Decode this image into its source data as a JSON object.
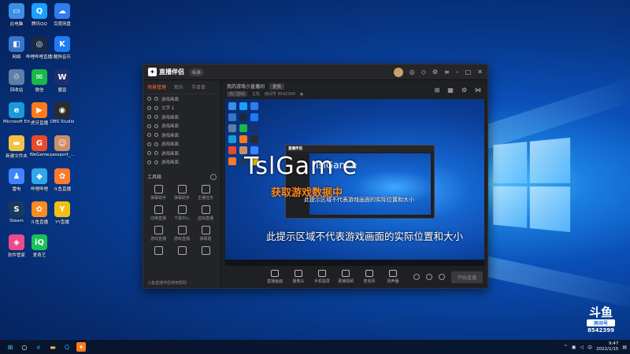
{
  "desktop": {
    "icons": [
      {
        "label": "此电脑",
        "color": "#3a8ee6",
        "glyph": "▭"
      },
      {
        "label": "腾讯QQ",
        "color": "#1aa0ff",
        "glyph": "Q"
      },
      {
        "label": "百度网盘",
        "color": "#2f7bf0",
        "glyph": "☁"
      },
      {
        "label": "网络",
        "color": "#3576c9",
        "glyph": "◧"
      },
      {
        "label": "哔哩哔哩直播姬",
        "color": "#1b2a44",
        "glyph": "◎"
      },
      {
        "label": "酷狗音乐",
        "color": "#1f7cf5",
        "glyph": "K"
      },
      {
        "label": "回收站",
        "color": "#5e7ea6",
        "glyph": "♲"
      },
      {
        "label": "微信",
        "color": "#18b84a",
        "glyph": "✉"
      },
      {
        "label": "魔兽",
        "color": "#1c2f6e",
        "glyph": "W"
      },
      {
        "label": "Microsoft Edge",
        "color": "#1a9ad8",
        "glyph": "e"
      },
      {
        "label": "虎牙直播",
        "color": "#ff7a1a",
        "glyph": "▶"
      },
      {
        "label": "OBS Studio",
        "color": "#2b2b2b",
        "glyph": "◉"
      },
      {
        "label": "新建文件夹",
        "color": "#f3c244",
        "glyph": "▬"
      },
      {
        "label": "WeGame",
        "color": "#e84a2a",
        "glyph": "G"
      },
      {
        "label": "passport_...",
        "color": "#c98f6a",
        "glyph": "☺"
      },
      {
        "label": "雷电",
        "color": "#3d86ff",
        "glyph": "♟"
      },
      {
        "label": "哔哩哔哩",
        "color": "#2fa7ea",
        "glyph": "◆"
      },
      {
        "label": "斗鱼直播",
        "color": "#ff7a2a",
        "glyph": "✿"
      },
      {
        "label": "Steam",
        "color": "#173a5e",
        "glyph": "S"
      },
      {
        "label": "斗鱼直播",
        "color": "#ff8a1f",
        "glyph": "✿"
      },
      {
        "label": "YY直播",
        "color": "#f2c012",
        "glyph": "Y"
      },
      {
        "label": "软件管家",
        "color": "#e94b8b",
        "glyph": "◈"
      },
      {
        "label": "爱奇艺",
        "color": "#18c25a",
        "glyph": "iQ"
      }
    ]
  },
  "app": {
    "title": "直播伴侣",
    "badge": "标准",
    "left_tabs": [
      "场景管理",
      "观众",
      "节目单"
    ],
    "scenes": [
      "游戏画面",
      "文字 1",
      "游戏画面",
      "游戏画面",
      "游戏画面",
      "游戏画面",
      "游戏画面",
      "游戏画面"
    ],
    "tools_label": "工具箱",
    "tools": [
      "弹幕助手",
      "弹幕助手",
      "主播任务",
      "切换直播",
      "下载中心",
      "虚拟直播",
      "游戏直播",
      "游戏直播",
      "弹幕姬",
      "",
      "",
      ""
    ],
    "left_footer": "斗鱼直播伴侣使用帮助",
    "stream_title": "我的游戏小直播间",
    "stream_tag": "更换",
    "info_tag1": "热门游戏",
    "info_tag2": "主机",
    "info_room": "房间号 8542399",
    "overlay_big": "TslGam  e",
    "overlay_orange": "获取游戏数据中",
    "overlay_small": "此提示区域不代表游戏画面的实际位置和大小",
    "overlay_main": "此提示区域不代表游戏画面的实际位置和大小",
    "nested_title": "直播伴侣",
    "nested_overlay": "TslGam  e",
    "controls": [
      "直播画面",
      "摄像头",
      "手机投屏",
      "录播视频",
      "麦克风",
      "扬声器"
    ],
    "start_button": "开始直播"
  },
  "watermark": {
    "logo": "斗鱼",
    "room_label": "房间号",
    "room_number": "8542399"
  },
  "taskbar": {
    "time": "9:47",
    "date": "2022/1/15"
  }
}
